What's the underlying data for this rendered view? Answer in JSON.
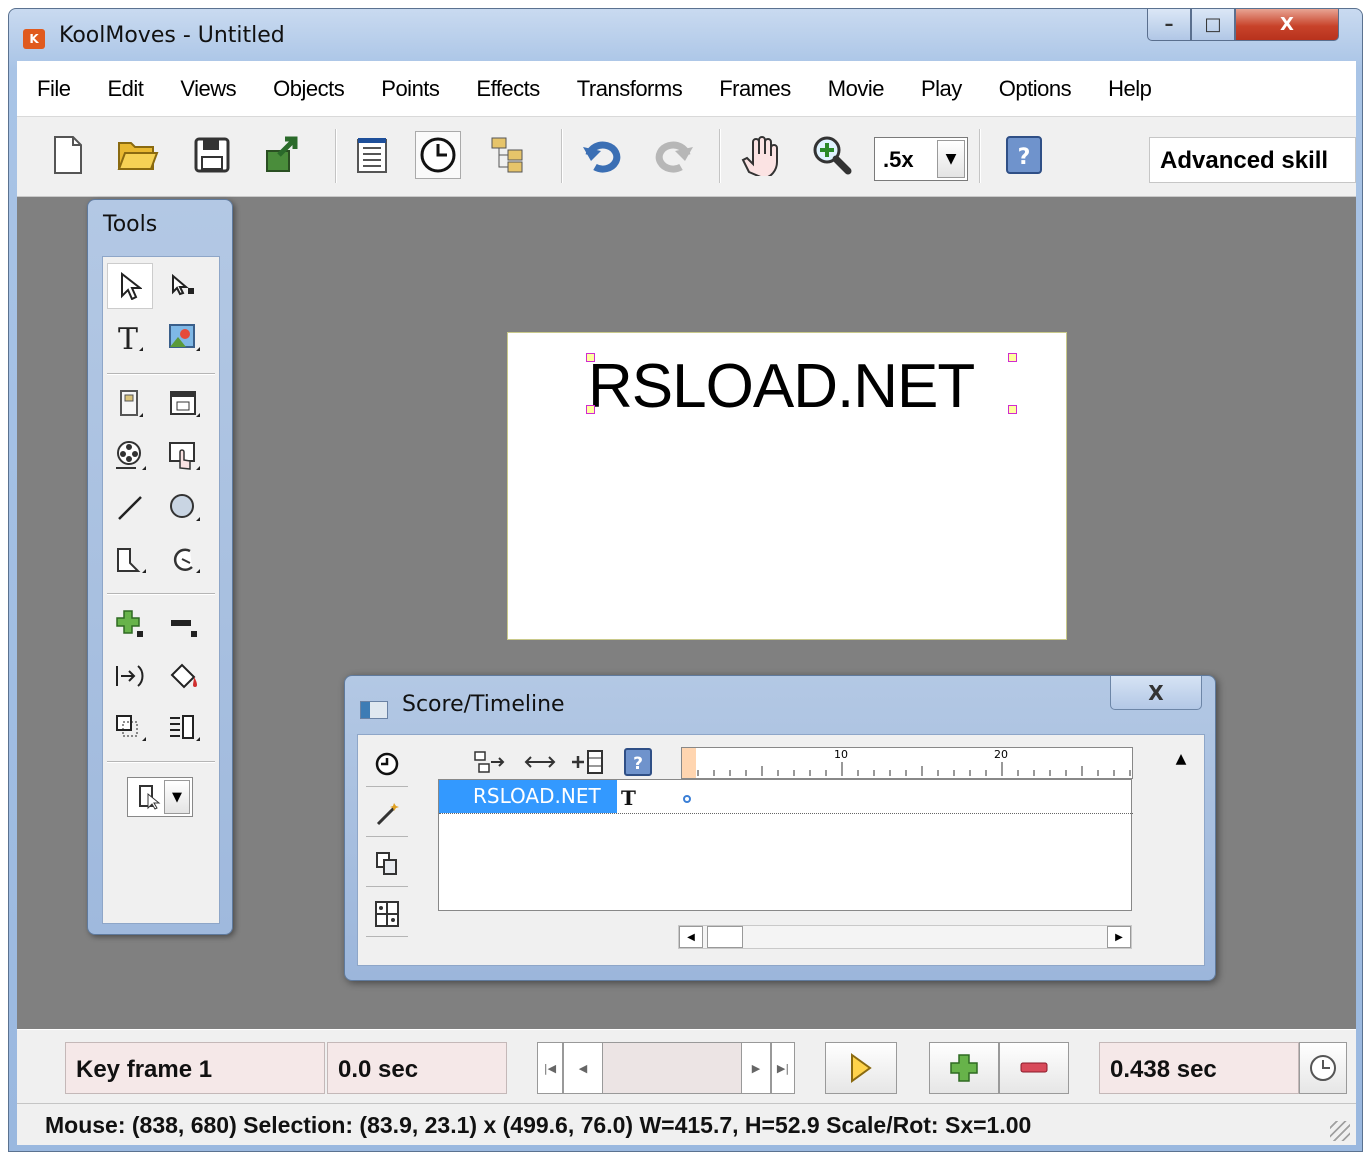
{
  "window": {
    "title": "KoolMoves - Untitled",
    "app_icon_label": "K",
    "minimize_label": "–",
    "maximize_label": "□",
    "close_label": "X"
  },
  "menubar": {
    "items": [
      "File",
      "Edit",
      "Views",
      "Objects",
      "Points",
      "Effects",
      "Transforms",
      "Frames",
      "Movie",
      "Play",
      "Options",
      "Help"
    ]
  },
  "toolbar": {
    "icons": [
      "new-file-icon",
      "open-folder-icon",
      "save-icon",
      "export-icon",
      "properties-icon",
      "timeline-clock-icon",
      "hierarchy-icon",
      "undo-icon",
      "redo-icon",
      "hand-icon",
      "zoom-icon",
      "help-icon"
    ],
    "zoom_value": ".5x",
    "skill_level": "Advanced skill"
  },
  "tools_palette": {
    "title": "Tools",
    "tools": [
      "arrow-select-icon",
      "subselect-icon",
      "text-tool-icon",
      "image-tool-icon",
      "button-tool-icon",
      "window-tool-icon",
      "movie-clip-icon",
      "hand-button-icon",
      "line-tool-icon",
      "ellipse-tool-icon",
      "polygon-tool-icon",
      "curve-tool-icon",
      "add-point-icon",
      "remove-point-icon",
      "morph-icon",
      "fill-bucket-icon",
      "transform-icon",
      "align-icon"
    ],
    "dropdown_icon": "selector-icon"
  },
  "stage": {
    "text": "RSLOAD.NET"
  },
  "score": {
    "title": "Score/Timeline",
    "close_label": "X",
    "side_icons": [
      "clock-icon",
      "wand-icon",
      "copy-icon",
      "grid-icon"
    ],
    "toolbar_icons": [
      "hierarchy-add-icon",
      "resize-horizontal-icon",
      "add-frame-icon",
      "help-icon"
    ],
    "ruler_labels": [
      "10",
      "20"
    ],
    "layers": [
      {
        "name": "RSLOAD.NET",
        "type_glyph": "T"
      }
    ]
  },
  "controlbar": {
    "keyframe": "Key frame 1",
    "time": "0.0 sec",
    "duration": "0.438 sec"
  },
  "status": {
    "text": "Mouse: (838, 680)  Selection: (83.9, 23.1) x (499.6, 76.0)  W=415.7,  H=52.9  Scale/Rot: Sx=1.00"
  }
}
